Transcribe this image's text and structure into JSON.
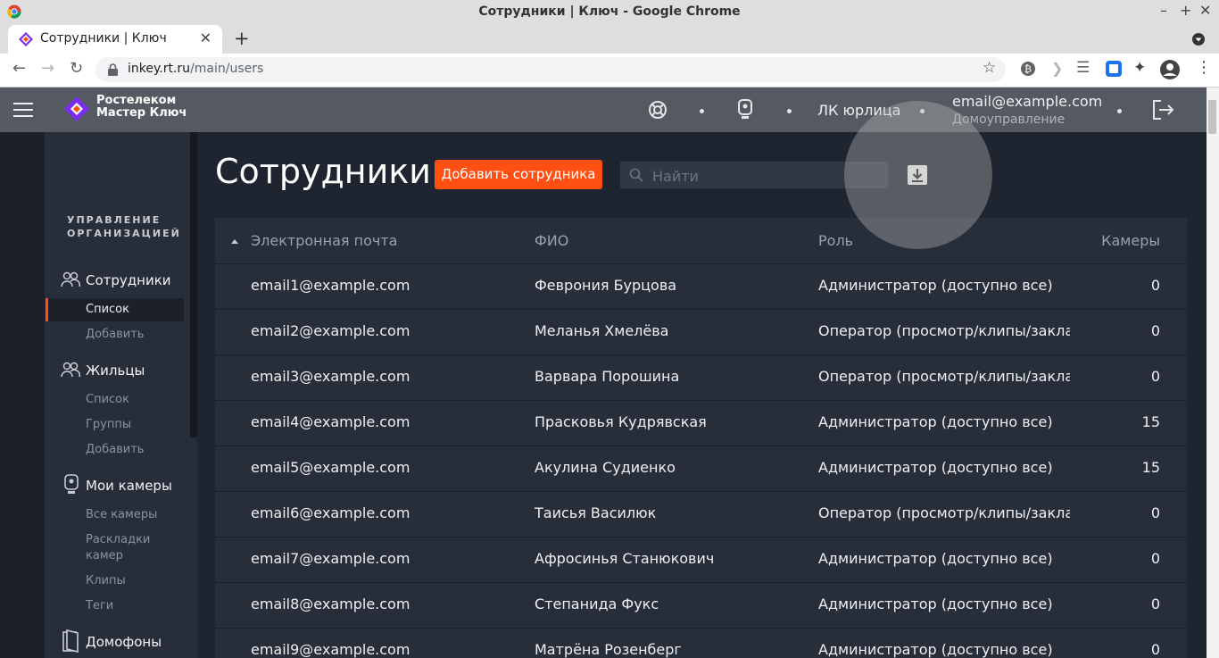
{
  "browser": {
    "window_title": "Сотрудники | Ключ - Google Chrome",
    "tab_title": "Сотрудники | Ключ",
    "url_host": "inkey.rt.ru",
    "url_path": "/main/users"
  },
  "header": {
    "logo_line1": "Ростелеком",
    "logo_line2": "Мастер Ключ",
    "account_type": "ЛК юрлица",
    "user_email": "email@example.com",
    "user_org": "Домоуправление"
  },
  "sidebar": {
    "group_title": "УПРАВЛЕНИЕ ОРГАНИЗАЦИЕЙ",
    "employees": {
      "label": "Сотрудники",
      "items": [
        "Список",
        "Добавить"
      ]
    },
    "residents": {
      "label": "Жильцы",
      "items": [
        "Список",
        "Группы",
        "Добавить"
      ]
    },
    "cameras": {
      "label": "Мои камеры",
      "items": [
        "Все камеры",
        "Раскладки камер",
        "Клипы",
        "Теги"
      ]
    },
    "intercoms": {
      "label": "Домофоны"
    }
  },
  "main": {
    "title": "Сотрудники",
    "add_button": "Добавить сотрудника",
    "search_placeholder": "Найти",
    "columns": [
      "Электронная почта",
      "ФИО",
      "Роль",
      "Камеры"
    ],
    "rows": [
      {
        "email": "email1@example.com",
        "name": "Феврония Бурцова",
        "role": "Администратор (доступно все)",
        "cameras": "0"
      },
      {
        "email": "email2@example.com",
        "name": "Меланья Хмелёва",
        "role": "Оператор (просмотр/клипы/закладки)",
        "cameras": "0"
      },
      {
        "email": "email3@example.com",
        "name": "Варвара Порошина",
        "role": "Оператор (просмотр/клипы/закладки)",
        "cameras": "0"
      },
      {
        "email": "email4@example.com",
        "name": "Прасковья Кудрявская",
        "role": "Администратор (доступно все)",
        "cameras": "15"
      },
      {
        "email": "email5@example.com",
        "name": "Акулина Судиенко",
        "role": "Администратор (доступно все)",
        "cameras": "15"
      },
      {
        "email": "email6@example.com",
        "name": "Таисья Василюк",
        "role": "Оператор (просмотр/клипы/закладки)",
        "cameras": "0"
      },
      {
        "email": "email7@example.com",
        "name": "Афросинья Станюкович",
        "role": "Администратор (доступно все)",
        "cameras": "0"
      },
      {
        "email": "email8@example.com",
        "name": "Степанида Фукс",
        "role": "Администратор (доступно все)",
        "cameras": "0"
      },
      {
        "email": "email9@example.com",
        "name": "Матрёна Розенберг",
        "role": "Администратор (доступно все)",
        "cameras": "0"
      }
    ]
  },
  "colors": {
    "accent": "#ff4f12",
    "header_bg": "#555a62",
    "content_bg": "#1e2530",
    "sidebar_bg": "#272e39"
  }
}
